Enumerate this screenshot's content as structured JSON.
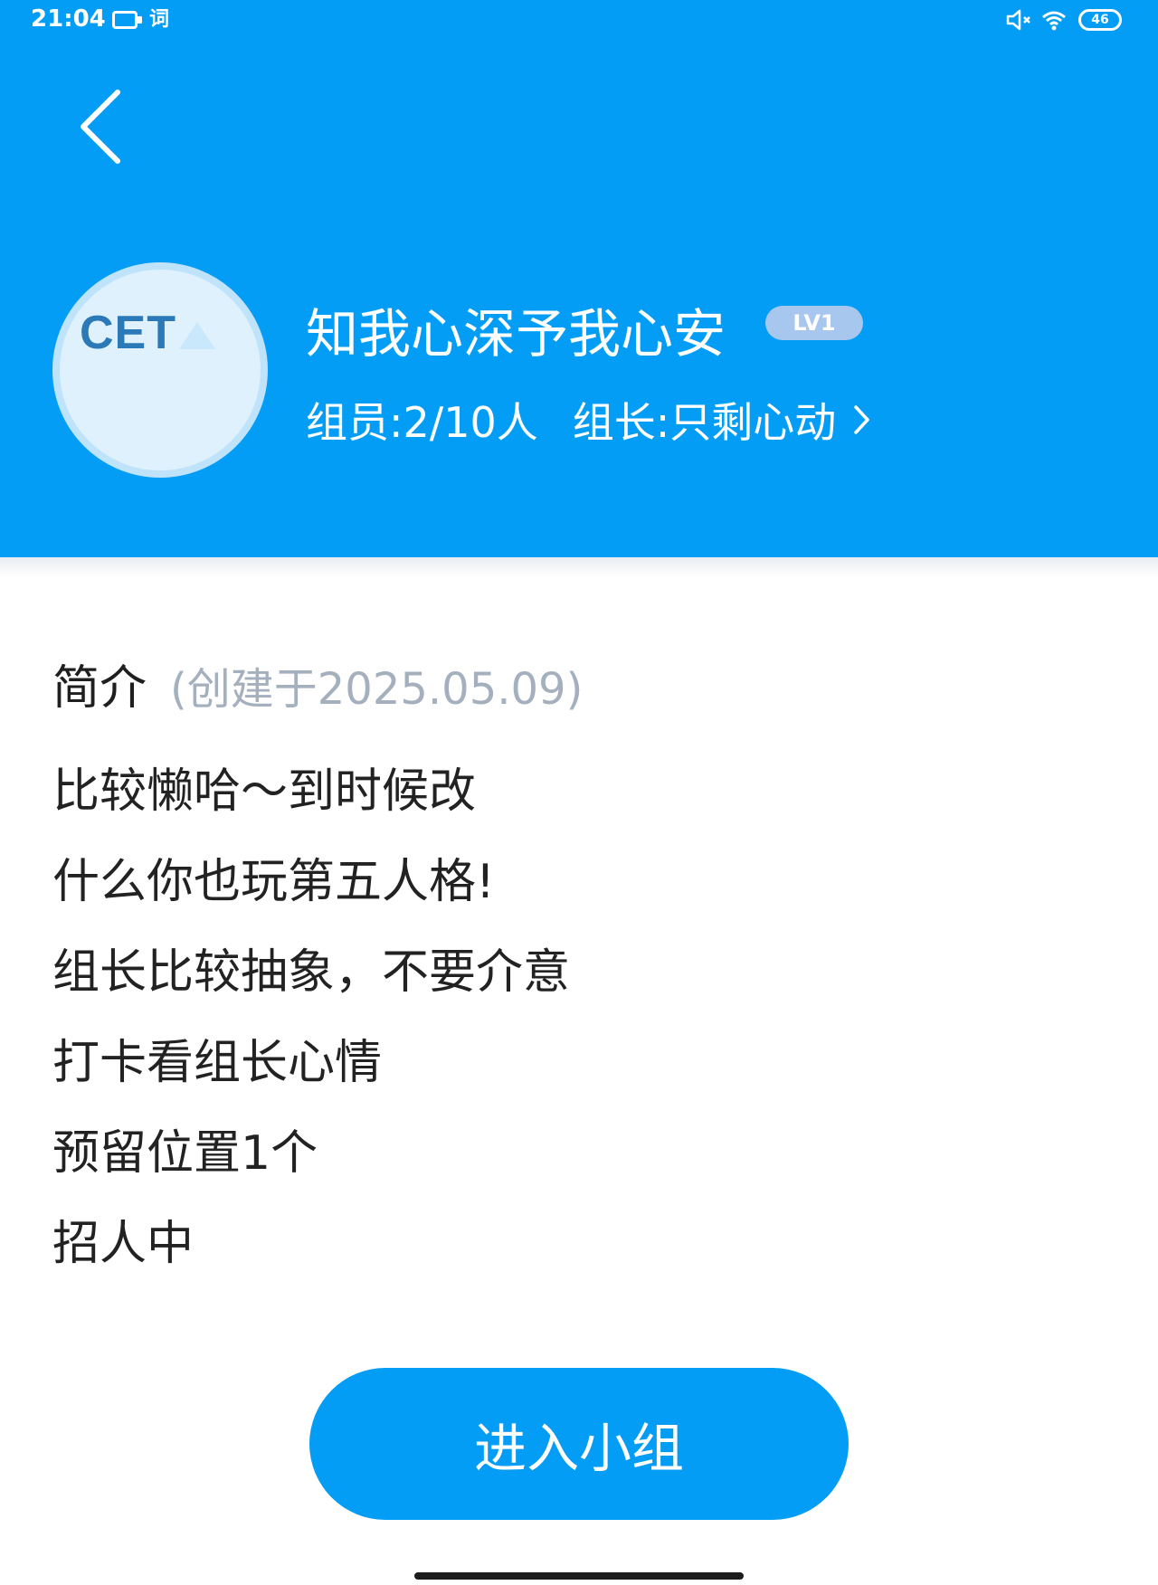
{
  "status_bar": {
    "time": "21:04",
    "word_icon_label": "词",
    "battery_level": "46"
  },
  "group": {
    "avatar_text": "CET",
    "name": "知我心深予我心安",
    "level": "LV1",
    "members": "组员:2/10人",
    "leader": "组长:只剩心动"
  },
  "intro": {
    "title": "简介",
    "created": "(创建于2025.05.09)",
    "lines": [
      "比较懒哈～到时候改",
      "什么你也玩第五人格!",
      "组长比较抽象，不要介意",
      "打卡看组长心情",
      "预留位置1个",
      "招人中"
    ]
  },
  "actions": {
    "enter_label": "进入小组"
  },
  "colors": {
    "header_blue": "#049df6",
    "badge": "#a7c7ee",
    "muted_text": "#a4b0bd"
  }
}
